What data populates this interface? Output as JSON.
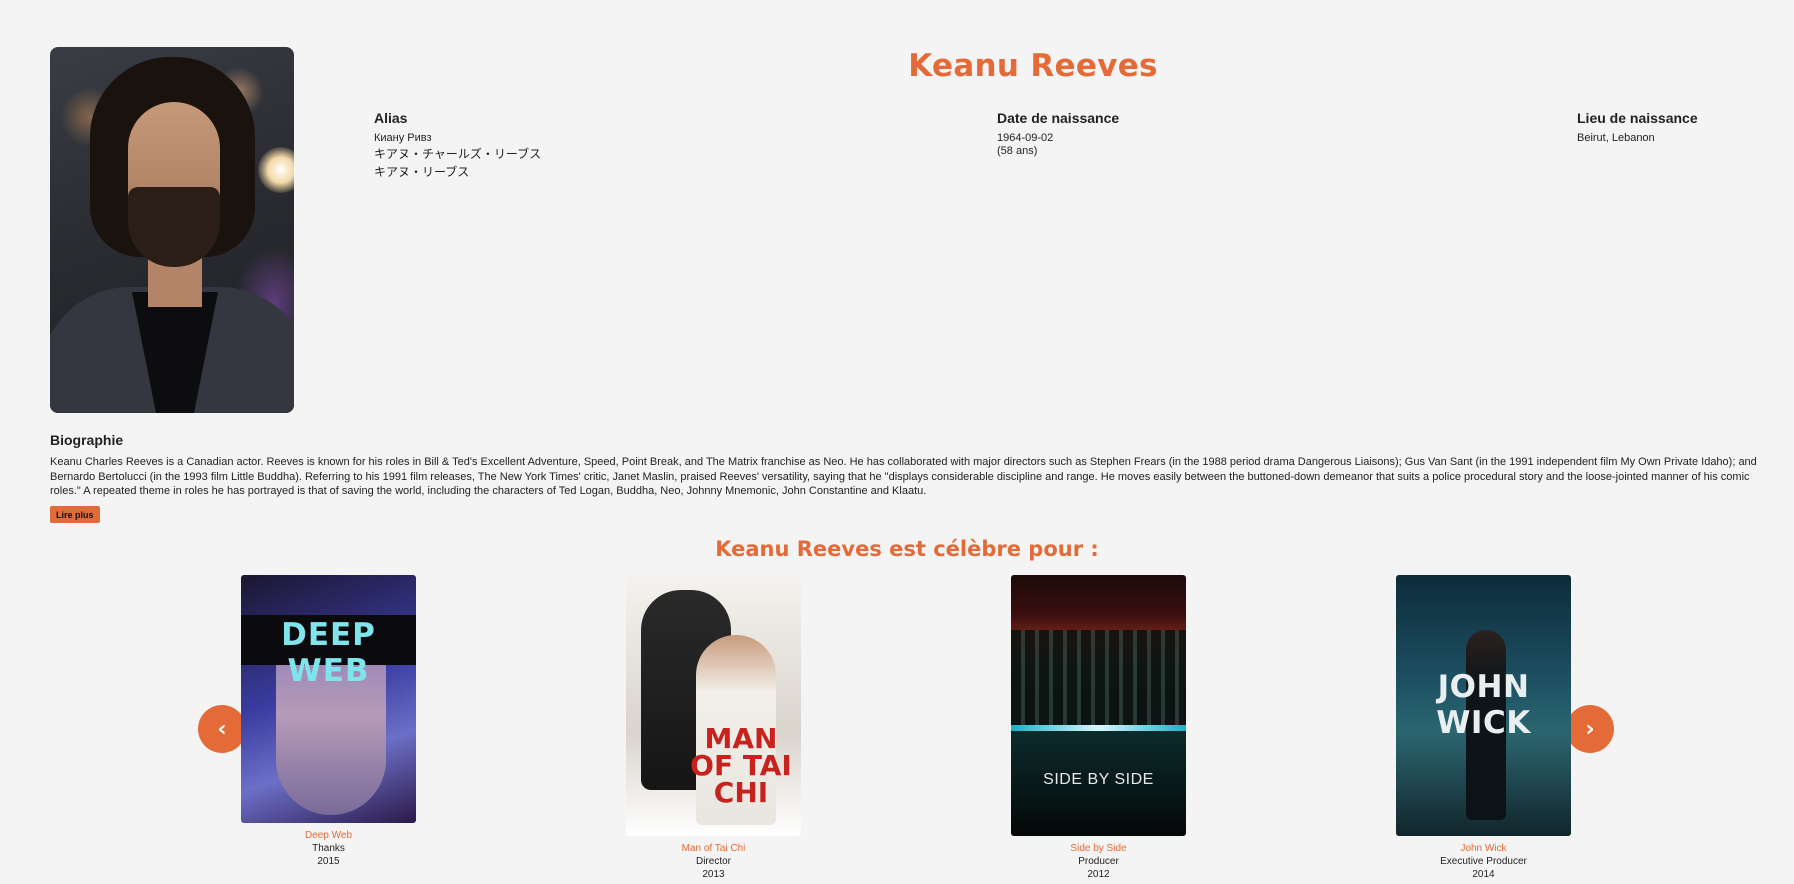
{
  "person": {
    "name": "Keanu Reeves",
    "photo_alt": "Keanu Reeves"
  },
  "info": {
    "alias": {
      "label": "Alias",
      "values": [
        "Киану Ривз",
        "キアヌ・チャールズ・リーブス",
        "キアヌ・リーブス"
      ]
    },
    "birth": {
      "label": "Date de naissance",
      "date": "1964-09-02",
      "age": "(58 ans)"
    },
    "birthplace": {
      "label": "Lieu de naissance",
      "value": "Beirut, Lebanon"
    }
  },
  "biography": {
    "title": "Biographie",
    "text": "Keanu Charles Reeves is a Canadian actor. Reeves is known for his roles in Bill & Ted's Excellent Adventure, Speed, Point Break, and The Matrix franchise as Neo. He has collaborated with major directors such as Stephen Frears (in the 1988 period drama Dangerous Liaisons); Gus Van Sant (in the 1991 independent film My Own Private Idaho); and Bernardo Bertolucci (in the 1993 film Little Buddha). Referring to his 1991 film releases, The New York Times' critic, Janet Maslin, praised Reeves' versatility, saying that he \"displays considerable discipline and range. He moves easily between the buttoned-down demeanor that suits a police procedural story and the loose-jointed manner of his comic roles.\" A repeated theme in roles he has portrayed is that of saving the world, including the characters of Ted Logan, Buddha, Neo, Johnny Mnemonic, John Constantine and Klaatu.",
    "read_more": "Lire plus"
  },
  "known_for": {
    "title": "Keanu Reeves est célèbre pour :",
    "prev": "‹",
    "next": "›",
    "movies": [
      {
        "title": "Deep Web",
        "role": "Thanks",
        "year": "2015",
        "poster_text": "DEEP WEB"
      },
      {
        "title": "Man of Tai Chi",
        "role": "Director",
        "year": "2013",
        "poster_text": "MAN OF TAI CHI"
      },
      {
        "title": "Side by Side",
        "role": "Producer",
        "year": "2012",
        "poster_text": "SIDE BY SIDE"
      },
      {
        "title": "John Wick",
        "role": "Executive Producer",
        "year": "2014",
        "poster_text": "JOHN WICK"
      }
    ]
  },
  "colors": {
    "accent": "#e46a37",
    "background": "#f4f4f4"
  }
}
